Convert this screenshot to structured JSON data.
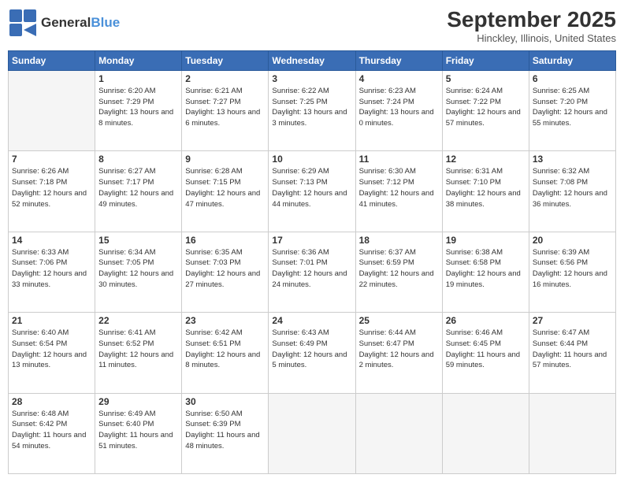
{
  "header": {
    "logo_general": "General",
    "logo_blue": "Blue",
    "month_title": "September 2025",
    "location": "Hinckley, Illinois, United States"
  },
  "weekdays": [
    "Sunday",
    "Monday",
    "Tuesday",
    "Wednesday",
    "Thursday",
    "Friday",
    "Saturday"
  ],
  "weeks": [
    [
      {
        "day": "",
        "sunrise": "",
        "sunset": "",
        "daylight": ""
      },
      {
        "day": "1",
        "sunrise": "6:20 AM",
        "sunset": "7:29 PM",
        "daylight": "13 hours and 8 minutes."
      },
      {
        "day": "2",
        "sunrise": "6:21 AM",
        "sunset": "7:27 PM",
        "daylight": "13 hours and 6 minutes."
      },
      {
        "day": "3",
        "sunrise": "6:22 AM",
        "sunset": "7:25 PM",
        "daylight": "13 hours and 3 minutes."
      },
      {
        "day": "4",
        "sunrise": "6:23 AM",
        "sunset": "7:24 PM",
        "daylight": "13 hours and 0 minutes."
      },
      {
        "day": "5",
        "sunrise": "6:24 AM",
        "sunset": "7:22 PM",
        "daylight": "12 hours and 57 minutes."
      },
      {
        "day": "6",
        "sunrise": "6:25 AM",
        "sunset": "7:20 PM",
        "daylight": "12 hours and 55 minutes."
      }
    ],
    [
      {
        "day": "7",
        "sunrise": "6:26 AM",
        "sunset": "7:18 PM",
        "daylight": "12 hours and 52 minutes."
      },
      {
        "day": "8",
        "sunrise": "6:27 AM",
        "sunset": "7:17 PM",
        "daylight": "12 hours and 49 minutes."
      },
      {
        "day": "9",
        "sunrise": "6:28 AM",
        "sunset": "7:15 PM",
        "daylight": "12 hours and 47 minutes."
      },
      {
        "day": "10",
        "sunrise": "6:29 AM",
        "sunset": "7:13 PM",
        "daylight": "12 hours and 44 minutes."
      },
      {
        "day": "11",
        "sunrise": "6:30 AM",
        "sunset": "7:12 PM",
        "daylight": "12 hours and 41 minutes."
      },
      {
        "day": "12",
        "sunrise": "6:31 AM",
        "sunset": "7:10 PM",
        "daylight": "12 hours and 38 minutes."
      },
      {
        "day": "13",
        "sunrise": "6:32 AM",
        "sunset": "7:08 PM",
        "daylight": "12 hours and 36 minutes."
      }
    ],
    [
      {
        "day": "14",
        "sunrise": "6:33 AM",
        "sunset": "7:06 PM",
        "daylight": "12 hours and 33 minutes."
      },
      {
        "day": "15",
        "sunrise": "6:34 AM",
        "sunset": "7:05 PM",
        "daylight": "12 hours and 30 minutes."
      },
      {
        "day": "16",
        "sunrise": "6:35 AM",
        "sunset": "7:03 PM",
        "daylight": "12 hours and 27 minutes."
      },
      {
        "day": "17",
        "sunrise": "6:36 AM",
        "sunset": "7:01 PM",
        "daylight": "12 hours and 24 minutes."
      },
      {
        "day": "18",
        "sunrise": "6:37 AM",
        "sunset": "6:59 PM",
        "daylight": "12 hours and 22 minutes."
      },
      {
        "day": "19",
        "sunrise": "6:38 AM",
        "sunset": "6:58 PM",
        "daylight": "12 hours and 19 minutes."
      },
      {
        "day": "20",
        "sunrise": "6:39 AM",
        "sunset": "6:56 PM",
        "daylight": "12 hours and 16 minutes."
      }
    ],
    [
      {
        "day": "21",
        "sunrise": "6:40 AM",
        "sunset": "6:54 PM",
        "daylight": "12 hours and 13 minutes."
      },
      {
        "day": "22",
        "sunrise": "6:41 AM",
        "sunset": "6:52 PM",
        "daylight": "12 hours and 11 minutes."
      },
      {
        "day": "23",
        "sunrise": "6:42 AM",
        "sunset": "6:51 PM",
        "daylight": "12 hours and 8 minutes."
      },
      {
        "day": "24",
        "sunrise": "6:43 AM",
        "sunset": "6:49 PM",
        "daylight": "12 hours and 5 minutes."
      },
      {
        "day": "25",
        "sunrise": "6:44 AM",
        "sunset": "6:47 PM",
        "daylight": "12 hours and 2 minutes."
      },
      {
        "day": "26",
        "sunrise": "6:46 AM",
        "sunset": "6:45 PM",
        "daylight": "11 hours and 59 minutes."
      },
      {
        "day": "27",
        "sunrise": "6:47 AM",
        "sunset": "6:44 PM",
        "daylight": "11 hours and 57 minutes."
      }
    ],
    [
      {
        "day": "28",
        "sunrise": "6:48 AM",
        "sunset": "6:42 PM",
        "daylight": "11 hours and 54 minutes."
      },
      {
        "day": "29",
        "sunrise": "6:49 AM",
        "sunset": "6:40 PM",
        "daylight": "11 hours and 51 minutes."
      },
      {
        "day": "30",
        "sunrise": "6:50 AM",
        "sunset": "6:39 PM",
        "daylight": "11 hours and 48 minutes."
      },
      {
        "day": "",
        "sunrise": "",
        "sunset": "",
        "daylight": ""
      },
      {
        "day": "",
        "sunrise": "",
        "sunset": "",
        "daylight": ""
      },
      {
        "day": "",
        "sunrise": "",
        "sunset": "",
        "daylight": ""
      },
      {
        "day": "",
        "sunrise": "",
        "sunset": "",
        "daylight": ""
      }
    ]
  ],
  "labels": {
    "sunrise": "Sunrise:",
    "sunset": "Sunset:",
    "daylight": "Daylight:"
  }
}
